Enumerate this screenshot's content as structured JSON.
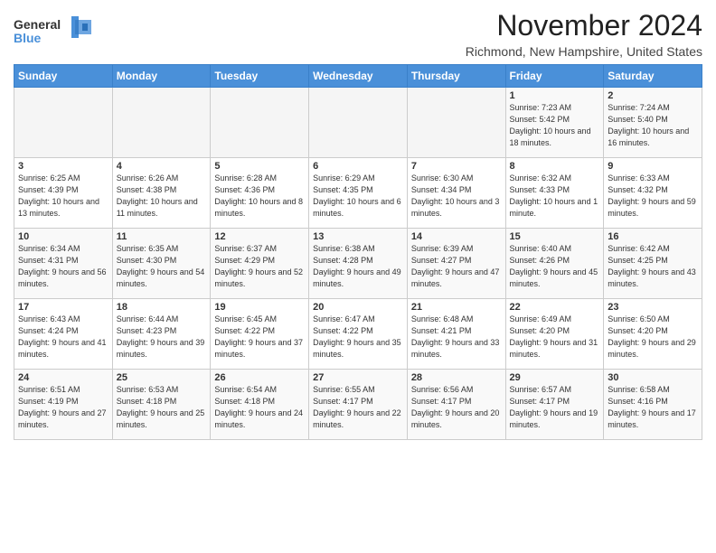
{
  "header": {
    "logo_line1": "General",
    "logo_line2": "Blue",
    "month_title": "November 2024",
    "location": "Richmond, New Hampshire, United States"
  },
  "calendar": {
    "headers": [
      "Sunday",
      "Monday",
      "Tuesday",
      "Wednesday",
      "Thursday",
      "Friday",
      "Saturday"
    ],
    "weeks": [
      [
        {
          "day": "",
          "info": ""
        },
        {
          "day": "",
          "info": ""
        },
        {
          "day": "",
          "info": ""
        },
        {
          "day": "",
          "info": ""
        },
        {
          "day": "",
          "info": ""
        },
        {
          "day": "1",
          "info": "Sunrise: 7:23 AM\nSunset: 5:42 PM\nDaylight: 10 hours and 18 minutes."
        },
        {
          "day": "2",
          "info": "Sunrise: 7:24 AM\nSunset: 5:40 PM\nDaylight: 10 hours and 16 minutes."
        }
      ],
      [
        {
          "day": "3",
          "info": "Sunrise: 6:25 AM\nSunset: 4:39 PM\nDaylight: 10 hours and 13 minutes."
        },
        {
          "day": "4",
          "info": "Sunrise: 6:26 AM\nSunset: 4:38 PM\nDaylight: 10 hours and 11 minutes."
        },
        {
          "day": "5",
          "info": "Sunrise: 6:28 AM\nSunset: 4:36 PM\nDaylight: 10 hours and 8 minutes."
        },
        {
          "day": "6",
          "info": "Sunrise: 6:29 AM\nSunset: 4:35 PM\nDaylight: 10 hours and 6 minutes."
        },
        {
          "day": "7",
          "info": "Sunrise: 6:30 AM\nSunset: 4:34 PM\nDaylight: 10 hours and 3 minutes."
        },
        {
          "day": "8",
          "info": "Sunrise: 6:32 AM\nSunset: 4:33 PM\nDaylight: 10 hours and 1 minute."
        },
        {
          "day": "9",
          "info": "Sunrise: 6:33 AM\nSunset: 4:32 PM\nDaylight: 9 hours and 59 minutes."
        }
      ],
      [
        {
          "day": "10",
          "info": "Sunrise: 6:34 AM\nSunset: 4:31 PM\nDaylight: 9 hours and 56 minutes."
        },
        {
          "day": "11",
          "info": "Sunrise: 6:35 AM\nSunset: 4:30 PM\nDaylight: 9 hours and 54 minutes."
        },
        {
          "day": "12",
          "info": "Sunrise: 6:37 AM\nSunset: 4:29 PM\nDaylight: 9 hours and 52 minutes."
        },
        {
          "day": "13",
          "info": "Sunrise: 6:38 AM\nSunset: 4:28 PM\nDaylight: 9 hours and 49 minutes."
        },
        {
          "day": "14",
          "info": "Sunrise: 6:39 AM\nSunset: 4:27 PM\nDaylight: 9 hours and 47 minutes."
        },
        {
          "day": "15",
          "info": "Sunrise: 6:40 AM\nSunset: 4:26 PM\nDaylight: 9 hours and 45 minutes."
        },
        {
          "day": "16",
          "info": "Sunrise: 6:42 AM\nSunset: 4:25 PM\nDaylight: 9 hours and 43 minutes."
        }
      ],
      [
        {
          "day": "17",
          "info": "Sunrise: 6:43 AM\nSunset: 4:24 PM\nDaylight: 9 hours and 41 minutes."
        },
        {
          "day": "18",
          "info": "Sunrise: 6:44 AM\nSunset: 4:23 PM\nDaylight: 9 hours and 39 minutes."
        },
        {
          "day": "19",
          "info": "Sunrise: 6:45 AM\nSunset: 4:22 PM\nDaylight: 9 hours and 37 minutes."
        },
        {
          "day": "20",
          "info": "Sunrise: 6:47 AM\nSunset: 4:22 PM\nDaylight: 9 hours and 35 minutes."
        },
        {
          "day": "21",
          "info": "Sunrise: 6:48 AM\nSunset: 4:21 PM\nDaylight: 9 hours and 33 minutes."
        },
        {
          "day": "22",
          "info": "Sunrise: 6:49 AM\nSunset: 4:20 PM\nDaylight: 9 hours and 31 minutes."
        },
        {
          "day": "23",
          "info": "Sunrise: 6:50 AM\nSunset: 4:20 PM\nDaylight: 9 hours and 29 minutes."
        }
      ],
      [
        {
          "day": "24",
          "info": "Sunrise: 6:51 AM\nSunset: 4:19 PM\nDaylight: 9 hours and 27 minutes."
        },
        {
          "day": "25",
          "info": "Sunrise: 6:53 AM\nSunset: 4:18 PM\nDaylight: 9 hours and 25 minutes."
        },
        {
          "day": "26",
          "info": "Sunrise: 6:54 AM\nSunset: 4:18 PM\nDaylight: 9 hours and 24 minutes."
        },
        {
          "day": "27",
          "info": "Sunrise: 6:55 AM\nSunset: 4:17 PM\nDaylight: 9 hours and 22 minutes."
        },
        {
          "day": "28",
          "info": "Sunrise: 6:56 AM\nSunset: 4:17 PM\nDaylight: 9 hours and 20 minutes."
        },
        {
          "day": "29",
          "info": "Sunrise: 6:57 AM\nSunset: 4:17 PM\nDaylight: 9 hours and 19 minutes."
        },
        {
          "day": "30",
          "info": "Sunrise: 6:58 AM\nSunset: 4:16 PM\nDaylight: 9 hours and 17 minutes."
        }
      ]
    ]
  }
}
